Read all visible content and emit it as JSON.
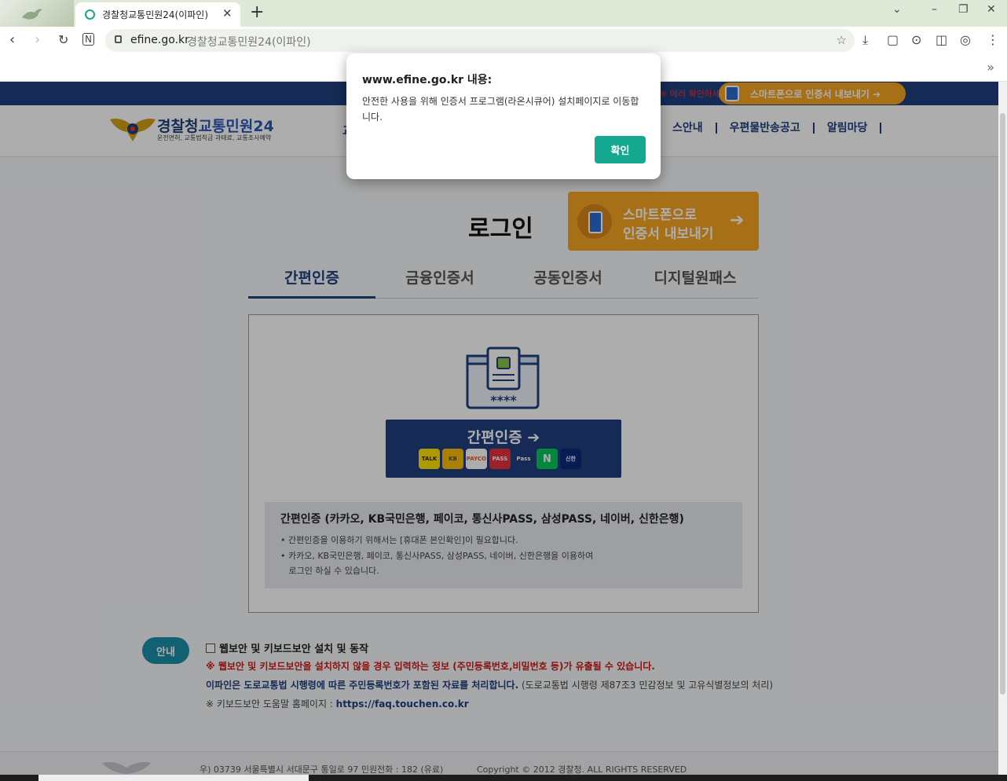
{
  "browser": {
    "tab_title": "경찰청교통민원24(이파인)",
    "tab_close": "✕",
    "new_tab": "+",
    "url": "efine.go.kr",
    "page_title": "경찰청교통민원24(이파인)",
    "more": "»",
    "window_controls": [
      "⌄",
      "–",
      "❐",
      "✕"
    ]
  },
  "site": {
    "topstrip_notice": "※ 에러 확인하세요",
    "cert_export_small": "스마트폰으로 인증서 내보내기 ➔",
    "logo_title_a": "경찰청",
    "logo_title_b": "교통민원24",
    "logo_sub": "운전면허, 교통범칙금 과태료, 교통조사예약",
    "gnb_partial": "교",
    "gnb": [
      "스안내",
      "우편물반송공고",
      "알림마당"
    ]
  },
  "login": {
    "title": "로그인",
    "cert_export_l1": "스마트폰으로",
    "cert_export_l2": "인증서 내보내기",
    "cert_export_arrow": "➔",
    "tabs": [
      "간편인증",
      "금융인증서",
      "공동인증서",
      "디지털원패스"
    ],
    "easy_button": "간편인증 ➔",
    "easy_logos": [
      "TALK",
      "KB",
      "PAYCO",
      "PASS",
      "Pass",
      "N",
      "신한"
    ],
    "info_title": "간편인증 (카카오, KB국민은행, 페이코, 통신사PASS, 삼성PASS, 네이버, 신한은행)",
    "info_lines": [
      "• 간편인증을 이용하기 위해서는 [휴대폰 본인확인]이 필요합니다.",
      "• 카카오, KB국민은행, 페이코, 통신사PASS, 삼성PASS, 네이버, 신한은행을 이용하여",
      "   로그인 하실 수 있습니다."
    ]
  },
  "notice": {
    "badge": "안내",
    "checkbox_label": "웹보안 및 키보드보안 설치 및 동작",
    "warning": "※ 웹보안 및 키보드보안을 설치하지 않을 경우 입력하는 정보 (주민등록번호,비밀번호 등)가 유출될 수 있습니다.",
    "privacy_bold": "이파인은 도로교통법 시행령에 따른 주민등록번호가 포함된 자료를 처리합니다.",
    "privacy_normal": " (도로교통법 시행령 제87조3 민감정보 및 고유식별정보의 처리)",
    "help_prefix": "※ 키보드보안 도움말 홈페이지 : ",
    "help_link": "https://faq.touchen.co.kr"
  },
  "footer": {
    "address": "우) 03739 서울특별시 서대문구 통일로 97   민원전화 : 182 (유료)",
    "copyright": "Copyright © 2012 경찰청. ALL RIGHTS RESERVED"
  },
  "dialog": {
    "title": "www.efine.go.kr 내용:",
    "message": "안전한 사용을 위해 인증서 프로그램(라온시큐어) 설치페이지로 이동합니다.",
    "ok": "확인"
  },
  "colors": {
    "brand_navy": "#1f3f7e",
    "accent_orange": "#f6a623",
    "dialog_button": "#13a88f",
    "warning_red": "#d01818"
  }
}
